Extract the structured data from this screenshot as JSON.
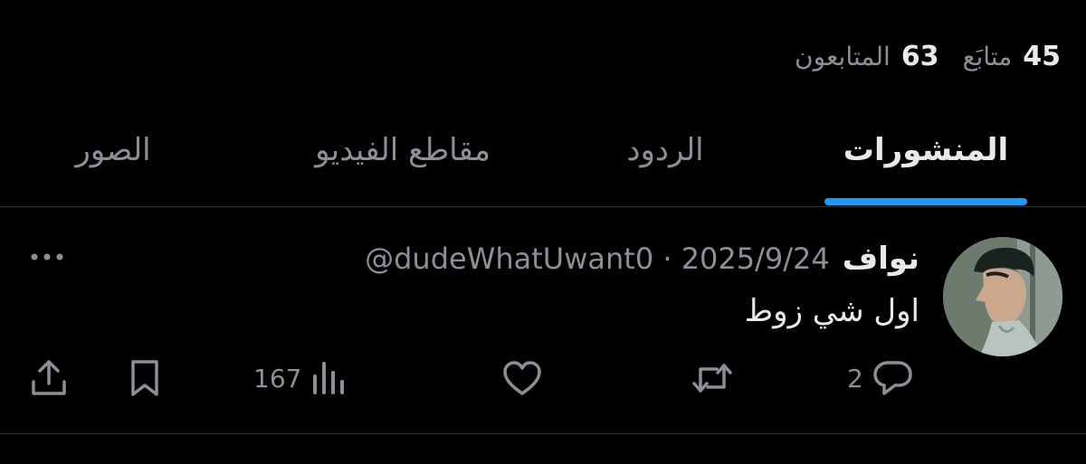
{
  "profile": {
    "following_count": "45",
    "following_label": "متابَع",
    "followers_count": "63",
    "followers_label": "المتابعون"
  },
  "tabs": [
    {
      "label": "المنشورات",
      "active": true
    },
    {
      "label": "الردود",
      "active": false
    },
    {
      "label": "مقاطع الفيديو",
      "active": false
    },
    {
      "label": "الصور",
      "active": false
    }
  ],
  "post": {
    "display_name": "نواف",
    "meta": "@dudeWhatUwant0 · 2025/9/24",
    "text": "اول شي زوط",
    "replies": "2",
    "views": "167"
  },
  "colors": {
    "background": "#000000",
    "accent": "#1d9bf0",
    "text_primary": "#e7e9ea",
    "text_secondary": "#8b9096",
    "divider": "#2f3336"
  },
  "icons": [
    "more-icon",
    "reply-icon",
    "repost-icon",
    "like-icon",
    "views-icon",
    "bookmark-icon",
    "share-icon"
  ]
}
